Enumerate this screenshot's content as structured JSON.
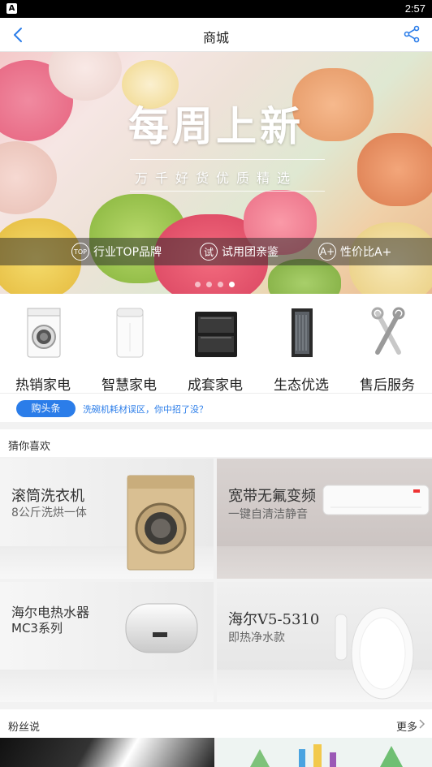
{
  "status_bar": {
    "app_icon": "A",
    "time": "2:57"
  },
  "navbar": {
    "title": "商城",
    "back_icon": "chevron-left-icon",
    "share_icon": "share-icon"
  },
  "banner": {
    "headline": "每周上新",
    "subheadline": "万千好货优质精选",
    "features": [
      {
        "badge": "TOP",
        "label": "行业TOP品牌"
      },
      {
        "badge": "试",
        "label": "试用团亲鉴"
      },
      {
        "badge": "A+",
        "label": "性价比A+"
      }
    ],
    "page_count": 4,
    "active_page": 4
  },
  "categories": [
    {
      "label": "热销家电",
      "icon": "washing-machine-icon"
    },
    {
      "label": "智慧家电",
      "icon": "air-purifier-icon"
    },
    {
      "label": "成套家电",
      "icon": "oven-icon"
    },
    {
      "label": "生态优选",
      "icon": "filter-icon"
    },
    {
      "label": "售后服务",
      "icon": "wrench-icon"
    }
  ],
  "news": {
    "tag": "购头条",
    "text": "洗碗机耗材误区，你中招了没？"
  },
  "recommend": {
    "title": "猜你喜欢",
    "cards": [
      {
        "title": "滚筒洗衣机",
        "subtitle": "8公斤洗烘一体"
      },
      {
        "title": "宽带无氟变频",
        "subtitle": "一键自清洁静音"
      },
      {
        "title": "海尔电热水器",
        "subtitle": "MC3系列"
      },
      {
        "title": "海尔V5-5310",
        "subtitle": "即热净水款"
      }
    ]
  },
  "fans": {
    "title": "粉丝说",
    "more": "更多"
  },
  "colors": {
    "accent": "#2b7de9",
    "background": "#f2f2f2"
  }
}
